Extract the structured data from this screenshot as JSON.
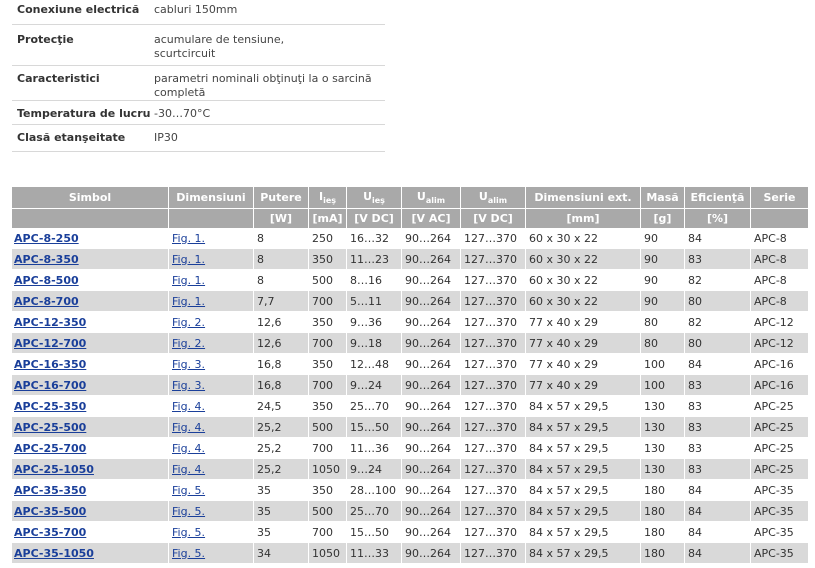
{
  "specs": [
    {
      "label": "Conexiune electrică",
      "value": [
        "cabluri 150mm"
      ]
    },
    {
      "label": "Protecţie",
      "value": [
        "acumulare de tensiune,",
        "scurtcircuit"
      ]
    },
    {
      "label": "Caracteristici",
      "value": [
        "parametri nominali obţinuţi la o sarcină completă"
      ]
    },
    {
      "label": "Temperatura de lucru",
      "value": [
        "-30…70°C"
      ]
    },
    {
      "label": "Clasă etanşeitate",
      "value": [
        "IP30"
      ]
    }
  ],
  "table": {
    "headers": [
      {
        "text": "Simbol",
        "sub": ""
      },
      {
        "text": "Dimensiuni",
        "sub": ""
      },
      {
        "text": "Putere",
        "sub": ""
      },
      {
        "text": "I",
        "sub": "ieş"
      },
      {
        "text": "U",
        "sub": "ieş"
      },
      {
        "text": "U",
        "sub": "alim"
      },
      {
        "text": "U",
        "sub": "alim"
      },
      {
        "text": "Dimensiuni ext.",
        "sub": ""
      },
      {
        "text": "Masă",
        "sub": ""
      },
      {
        "text": "Eficienţă",
        "sub": ""
      },
      {
        "text": "Serie",
        "sub": ""
      }
    ],
    "units": [
      "",
      "",
      "[W]",
      "[mA]",
      "[V DC]",
      "[V AC]",
      "[V DC]",
      "[mm]",
      "[g]",
      "[%]",
      ""
    ],
    "rows": [
      [
        "APC-8-250",
        "Fig. 1.",
        "8",
        "250",
        "16…32",
        "90…264",
        "127…370",
        "60 x 30 x 22",
        "90",
        "84",
        "APC-8"
      ],
      [
        "APC-8-350",
        "Fig. 1.",
        "8",
        "350",
        "11…23",
        "90…264",
        "127…370",
        "60 x 30 x 22",
        "90",
        "83",
        "APC-8"
      ],
      [
        "APC-8-500",
        "Fig. 1.",
        "8",
        "500",
        "8…16",
        "90…264",
        "127…370",
        "60 x 30 x 22",
        "90",
        "82",
        "APC-8"
      ],
      [
        "APC-8-700",
        "Fig. 1.",
        "7,7",
        "700",
        "5…11",
        "90…264",
        "127…370",
        "60 x 30 x 22",
        "90",
        "80",
        "APC-8"
      ],
      [
        "APC-12-350",
        "Fig. 2.",
        "12,6",
        "350",
        "9…36",
        "90…264",
        "127…370",
        "77 x 40 x 29",
        "80",
        "82",
        "APC-12"
      ],
      [
        "APC-12-700",
        "Fig. 2.",
        "12,6",
        "700",
        "9…18",
        "90…264",
        "127…370",
        "77 x 40 x 29",
        "80",
        "80",
        "APC-12"
      ],
      [
        "APC-16-350",
        "Fig. 3.",
        "16,8",
        "350",
        "12…48",
        "90…264",
        "127…370",
        "77 x 40 x 29",
        "100",
        "84",
        "APC-16"
      ],
      [
        "APC-16-700",
        "Fig. 3.",
        "16,8",
        "700",
        "9…24",
        "90…264",
        "127…370",
        "77 x 40 x 29",
        "100",
        "83",
        "APC-16"
      ],
      [
        "APC-25-350",
        "Fig. 4.",
        "24,5",
        "350",
        "25…70",
        "90…264",
        "127…370",
        "84 x 57 x 29,5",
        "130",
        "83",
        "APC-25"
      ],
      [
        "APC-25-500",
        "Fig. 4.",
        "25,2",
        "500",
        "15…50",
        "90…264",
        "127…370",
        "84 x 57 x 29,5",
        "130",
        "83",
        "APC-25"
      ],
      [
        "APC-25-700",
        "Fig. 4.",
        "25,2",
        "700",
        "11…36",
        "90…264",
        "127…370",
        "84 x 57 x 29,5",
        "130",
        "83",
        "APC-25"
      ],
      [
        "APC-25-1050",
        "Fig. 4.",
        "25,2",
        "1050",
        "9…24",
        "90…264",
        "127…370",
        "84 x 57 x 29,5",
        "130",
        "83",
        "APC-25"
      ],
      [
        "APC-35-350",
        "Fig. 5.",
        "35",
        "350",
        "28…100",
        "90…264",
        "127…370",
        "84 x 57 x 29,5",
        "180",
        "84",
        "APC-35"
      ],
      [
        "APC-35-500",
        "Fig. 5.",
        "35",
        "500",
        "25…70",
        "90…264",
        "127…370",
        "84 x 57 x 29,5",
        "180",
        "84",
        "APC-35"
      ],
      [
        "APC-35-700",
        "Fig. 5.",
        "35",
        "700",
        "15…50",
        "90…264",
        "127…370",
        "84 x 57 x 29,5",
        "180",
        "84",
        "APC-35"
      ],
      [
        "APC-35-1050",
        "Fig. 5.",
        "34",
        "1050",
        "11…33",
        "90…264",
        "127…370",
        "84 x 57 x 29,5",
        "180",
        "84",
        "APC-35"
      ]
    ]
  }
}
